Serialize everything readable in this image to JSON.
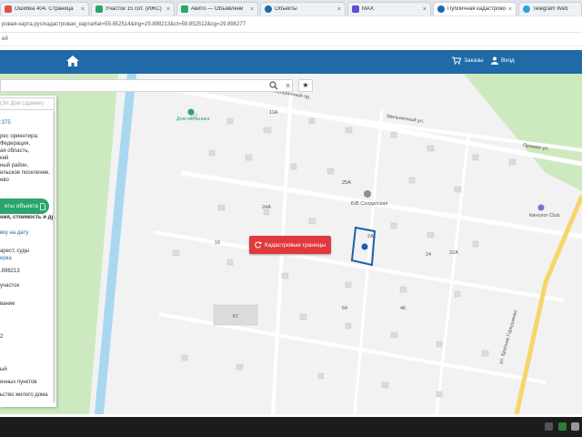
{
  "browser": {
    "tabs": [
      {
        "label": "Ошибка 404. Страница",
        "active": false,
        "icon": "doc-red-icon",
        "color": "#d9534f"
      },
      {
        "label": "Участок 15 сот. (ИЖС)",
        "active": false,
        "icon": "avito-icon",
        "color": "#2aa56b"
      },
      {
        "label": "Авито — Объявлени",
        "active": false,
        "icon": "avito-icon",
        "color": "#2aa56b"
      },
      {
        "label": "Объекты",
        "active": false,
        "icon": "globe-icon",
        "color": "#1f6aa7"
      },
      {
        "label": "MAX",
        "active": false,
        "icon": "max-icon",
        "color": "#6a4ccf"
      },
      {
        "label": "Публичная кадастрово",
        "active": true,
        "icon": "globe-icon",
        "color": "#1f6aa7"
      },
      {
        "label": "Telegram Web",
        "active": false,
        "icon": "telegram-icon",
        "color": "#2aa3dd"
      }
    ],
    "tab_close": "×",
    "url": "ровая-карта.рус/кадастровая_карта#lat=59.852514&lng=29.898213&ct=59.852512&cg=29.898277",
    "bookmarks_text": "ей"
  },
  "header": {
    "orders_label": "Заказы",
    "login_label": "Вход"
  },
  "search": {
    "clear_label": "×",
    "star_label": "★"
  },
  "panel": {
    "input_placeholder": "(Эл Дом (здание)",
    "lines": [
      {
        "text": ":375",
        "blue": true
      },
      {
        "text": "рес ориентира:",
        "blue": false
      },
      {
        "text": "Федерация,",
        "blue": false
      },
      {
        "text": "ая область,",
        "blue": false
      },
      {
        "text": "кий",
        "blue": false
      },
      {
        "text": "ный район,",
        "blue": false
      },
      {
        "text": "ельское поселение,",
        "blue": false
      },
      {
        "text": "ево",
        "blue": false
      }
    ],
    "docs_button": "нты объекта",
    "docs_sub": "ния, стоимость и др.",
    "lines2": [
      {
        "text": "вку на дату",
        "blue": true
      },
      {
        "text": "арест, суды",
        "blue": false
      },
      {
        "text": "ерка",
        "blue": true
      },
      {
        "text": ".898213",
        "blue": false
      },
      {
        "text": "участок",
        "blue": false
      },
      {
        "text": "вание",
        "blue": false
      },
      {
        "text": "2",
        "blue": false
      },
      {
        "text": "ый",
        "blue": false
      },
      {
        "text": "енных пунктов",
        "blue": false
      },
      {
        "text": "ьство жилого дома",
        "blue": false
      }
    ]
  },
  "map": {
    "cadastral_button": "Кадастровые границы",
    "labels": [
      {
        "text": "Дом мельника"
      },
      {
        "text": "Мельничный пр."
      },
      {
        "text": "Мельничный ул."
      },
      {
        "text": "Прямая ул."
      },
      {
        "text": "Б/В Солдатская"
      },
      {
        "text": "Кинолог Club"
      },
      {
        "text": "ул. Братьев Горкушенко"
      },
      {
        "text": "11А"
      },
      {
        "text": "25А"
      },
      {
        "text": "24А"
      },
      {
        "text": "2А"
      },
      {
        "text": "22А"
      },
      {
        "text": "24"
      },
      {
        "text": "16"
      },
      {
        "text": "46"
      },
      {
        "text": "64"
      },
      {
        "text": "67"
      }
    ]
  },
  "colors": {
    "header_bg": "#1f6aa7",
    "cadastral_button_bg": "#e03a3e",
    "docs_button_bg": "#2aa56b",
    "water": "#a9d7f0",
    "parcel": "#1f5fa8"
  }
}
